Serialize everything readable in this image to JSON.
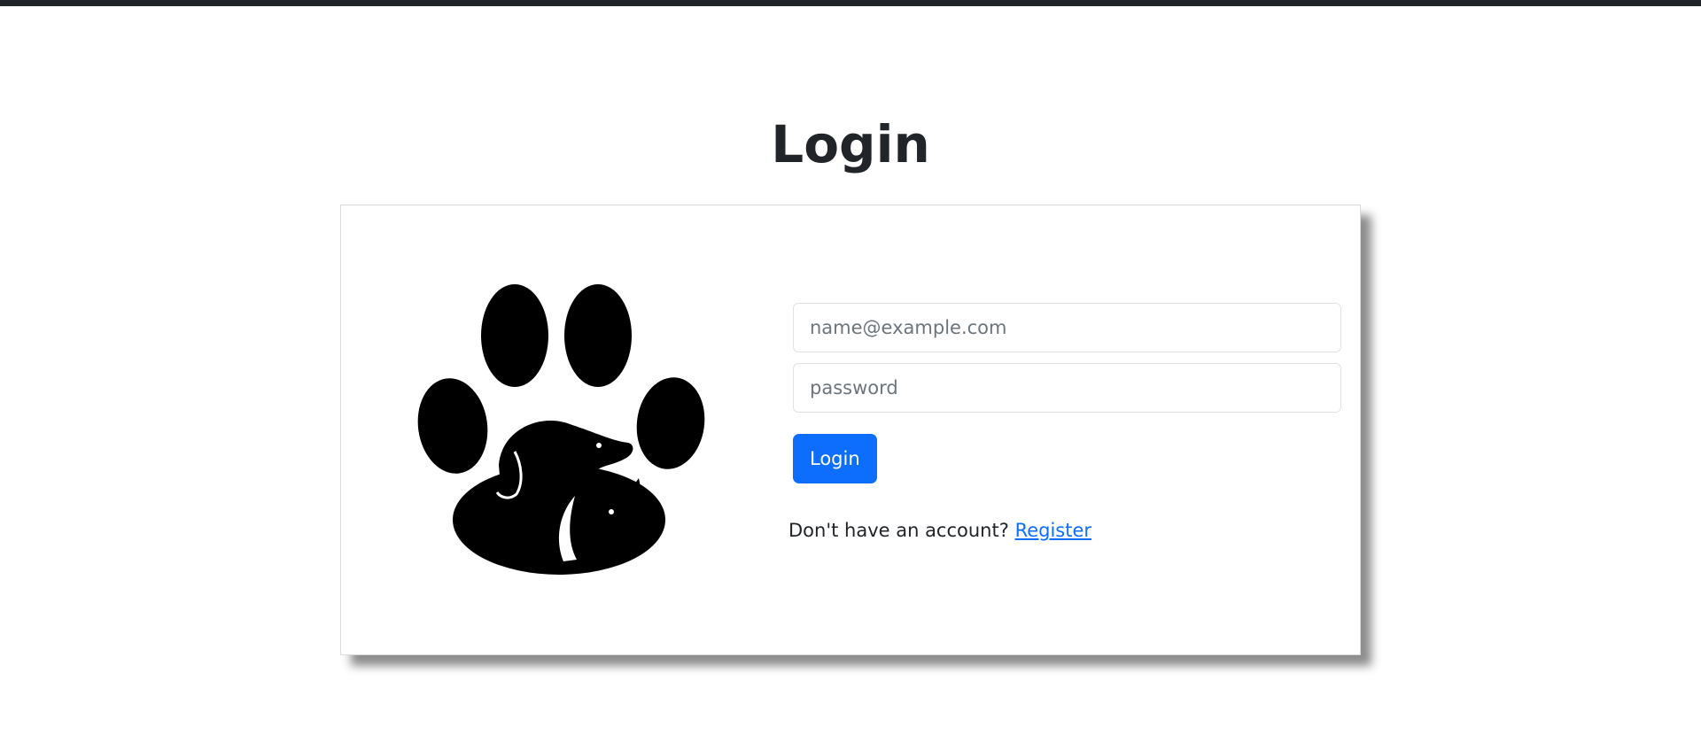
{
  "page": {
    "title": "Login"
  },
  "logo": {
    "icon": "paw-dog-cat-logo-icon"
  },
  "form": {
    "email_placeholder": "name@example.com",
    "email_value": "",
    "password_placeholder": "password",
    "password_value": "",
    "login_label": "Login"
  },
  "register": {
    "prompt": "Don't have an account?",
    "link_label": "Register"
  },
  "colors": {
    "accent": "#0d6efd",
    "top_bar": "#212529",
    "text": "#212529"
  }
}
